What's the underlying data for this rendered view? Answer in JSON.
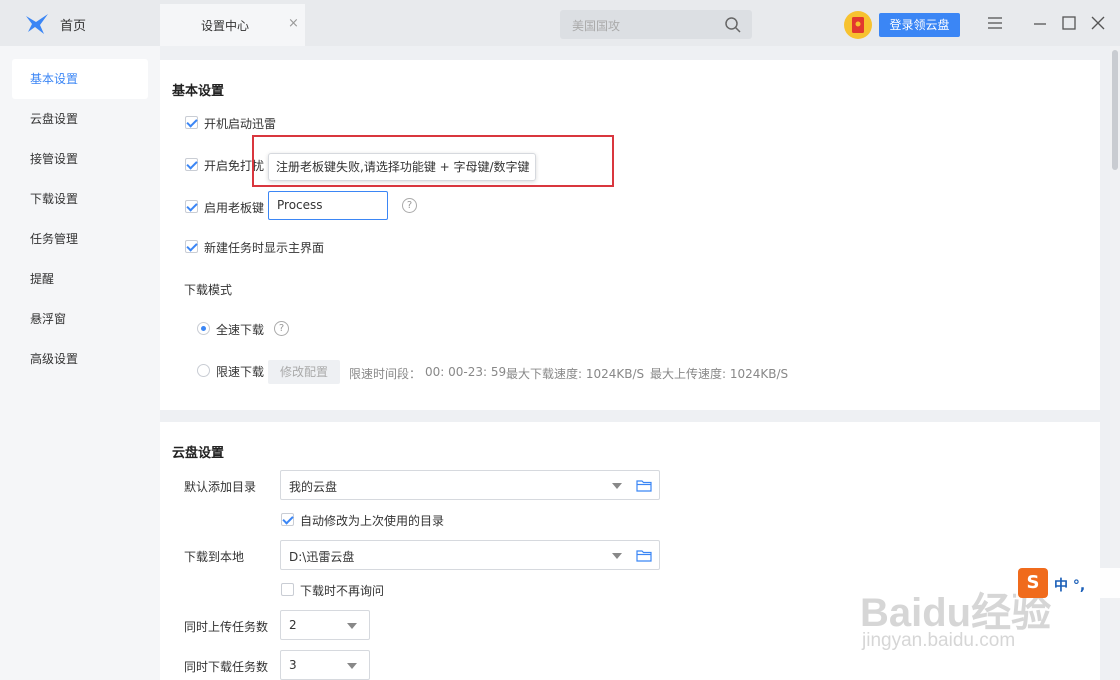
{
  "topbar": {
    "home_label": "首页",
    "tab_label": "设置中心",
    "tab_close": "×",
    "search_placeholder": "美国国攻",
    "login_button": "登录领云盘"
  },
  "sidebar": {
    "items": [
      {
        "label": "基本设置",
        "active": true
      },
      {
        "label": "云盘设置"
      },
      {
        "label": "接管设置"
      },
      {
        "label": "下载设置"
      },
      {
        "label": "任务管理"
      },
      {
        "label": "提醒"
      },
      {
        "label": "悬浮窗"
      },
      {
        "label": "高级设置"
      }
    ]
  },
  "basic": {
    "title": "基本设置",
    "startup": "开机启动迅雷",
    "nodisturb": "开启免打扰",
    "bosskey": "启用老板键",
    "bosskey_value": "Process",
    "show_main": "新建任务时显示主界面",
    "tooltip": "注册老板键失败,请选择功能键 + 字母键/数字键",
    "download_mode_label": "下载模式",
    "full_speed": "全速下载",
    "limit_speed": "限速下载",
    "modify_config": "修改配置",
    "limit_period_label": "限速时间段：",
    "limit_period_value": "00: 00-23: 59",
    "max_download": "最大下载速度: 1024KB/S",
    "max_upload": "最大上传速度: 1024KB/S"
  },
  "cloud": {
    "title": "云盘设置",
    "default_dir_label": "默认添加目录",
    "default_dir_value": "我的云盘",
    "auto_modify": "自动修改为上次使用的目录",
    "download_local_label": "下载到本地",
    "download_local_value": "D:\\迅雷云盘",
    "no_ask": "下载时不再询问",
    "upload_tasks_label": "同时上传任务数",
    "upload_tasks_value": "2",
    "download_tasks_label": "同时下载任务数",
    "download_tasks_value": "3"
  },
  "watermark": {
    "brand": "Baidu经验",
    "url": "jingyan.baidu.com"
  },
  "ime": {
    "logo": "S",
    "text": "中 °,"
  },
  "colors": {
    "accent": "#3b86f5",
    "highlight_box": "#d9363e"
  }
}
